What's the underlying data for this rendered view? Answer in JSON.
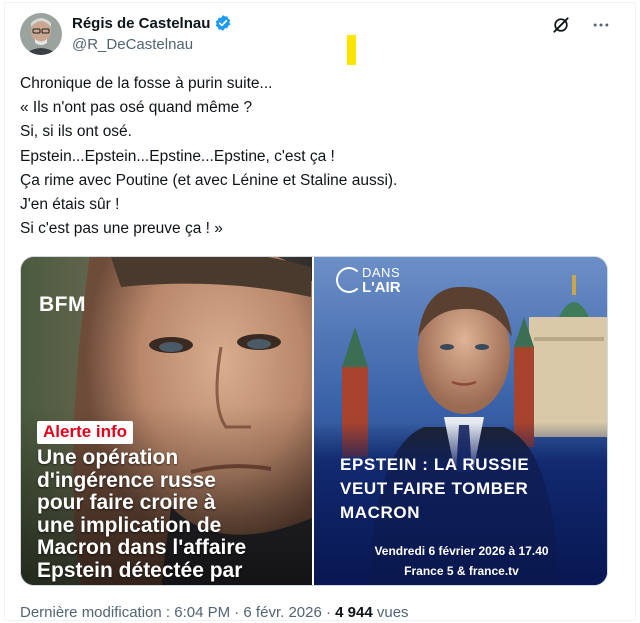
{
  "author": {
    "name": "Régis de Castelnau",
    "handle": "@R_DeCastelnau",
    "verified": true,
    "verified_color": "#1d9bf0"
  },
  "icons": {
    "top_right": [
      "grok-icon",
      "more-options-icon"
    ]
  },
  "tweet": {
    "lines": [
      "Chronique de la fosse à purin suite...",
      "« Ils n'ont pas osé quand même ?",
      "Si, si ils ont osé.",
      "Epstein...Epstein...Epstine...Epstine, c'est ça !",
      "Ça rime avec Poutine (et avec Lénine et Staline aussi).",
      "J'en étais sûr !",
      "Si c'est pas une preuve ça ! »"
    ]
  },
  "media": {
    "left": {
      "logo": "BFM",
      "badge": "Alerte info",
      "headline_lines": [
        "Une opération",
        "d'ingérence russe",
        "pour faire croire à",
        "une implication de",
        "Macron dans l'affaire",
        "Epstein détectée par"
      ]
    },
    "right": {
      "logo_top": "DANS",
      "logo_bottom": "L'AIR",
      "headline_lines": [
        "EPSTEIN : LA RUSSIE",
        "VEUT FAIRE TOMBER",
        "MACRON"
      ],
      "footer_line1": "Vendredi 6 février 2026 à 17.40",
      "footer_line2": "France 5 & france.tv"
    }
  },
  "meta": {
    "prefix": "Dernière modification : 6:04 PM · 6 févr. 2026 · ",
    "views_count": "4 944",
    "views_label": " vues"
  },
  "colors": {
    "alert_red": "#e2001a",
    "highlight_yellow": "#ffe500",
    "text_secondary": "#536471"
  }
}
